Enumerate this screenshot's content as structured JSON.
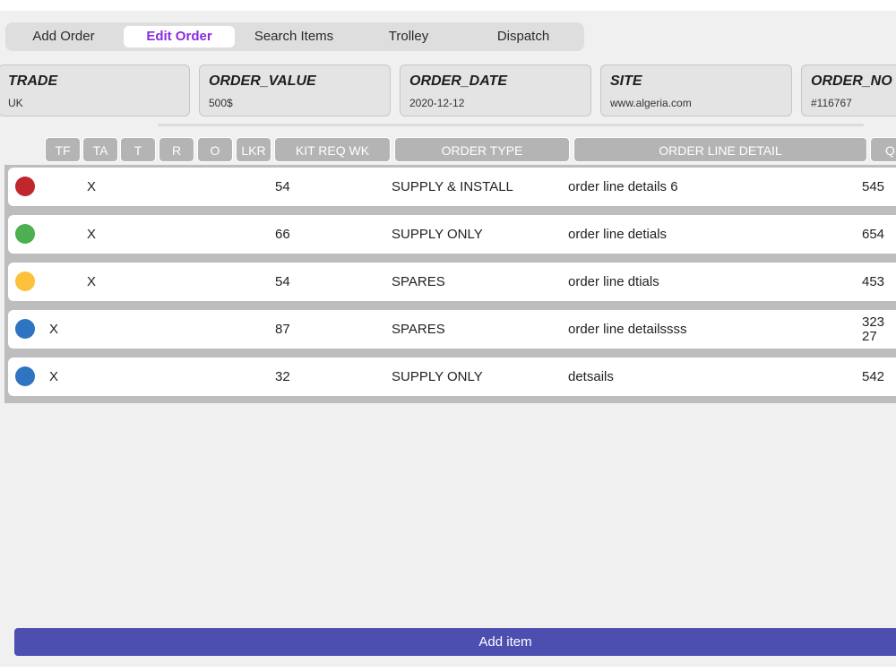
{
  "tabs": [
    {
      "label": "Add Order"
    },
    {
      "label": "Edit Order",
      "active": true
    },
    {
      "label": "Search Items"
    },
    {
      "label": "Trolley"
    },
    {
      "label": "Dispatch"
    }
  ],
  "cards": [
    {
      "label": "TRADE",
      "value": "UK"
    },
    {
      "label": "ORDER_VALUE",
      "value": "500$"
    },
    {
      "label": "ORDER_DATE",
      "value": "2020-12-12"
    },
    {
      "label": "SITE",
      "value": "www.algeria.com"
    },
    {
      "label": "ORDER_NO",
      "value": "#116767"
    }
  ],
  "table": {
    "columns": [
      "TF",
      "TA",
      "T",
      "R",
      "O",
      "LKR",
      "KIT REQ WK",
      "ORDER TYPE",
      "ORDER LINE DETAIL",
      "Q"
    ],
    "rows": [
      {
        "status_color": "#c0262c",
        "tf": "",
        "ta": "X",
        "kit_req_wk": "54",
        "order_type": "SUPPLY & INSTALL",
        "detail": "order line details 6",
        "qty": "545"
      },
      {
        "status_color": "#4caf50",
        "tf": "",
        "ta": "X",
        "kit_req_wk": "66",
        "order_type": "SUPPLY ONLY",
        "detail": "order line detials",
        "qty": "654"
      },
      {
        "status_color": "#fbc13b",
        "tf": "",
        "ta": "X",
        "kit_req_wk": "54",
        "order_type": "SPARES",
        "detail": "order line dtials",
        "qty": "453"
      },
      {
        "status_color": "#2f74c0",
        "tf": "X",
        "ta": "",
        "kit_req_wk": "87",
        "order_type": "SPARES",
        "detail": "order line detailssss",
        "qty": "32327"
      },
      {
        "status_color": "#2f74c0",
        "tf": "X",
        "ta": "",
        "kit_req_wk": "32",
        "order_type": "SUPPLY ONLY",
        "detail": "detsails",
        "qty": "542"
      }
    ]
  },
  "add_item_label": "Add item",
  "colors": {
    "accent_tab": "#8a2be2",
    "button": "#4c4eb0",
    "header_bg": "#b4b4b4"
  }
}
